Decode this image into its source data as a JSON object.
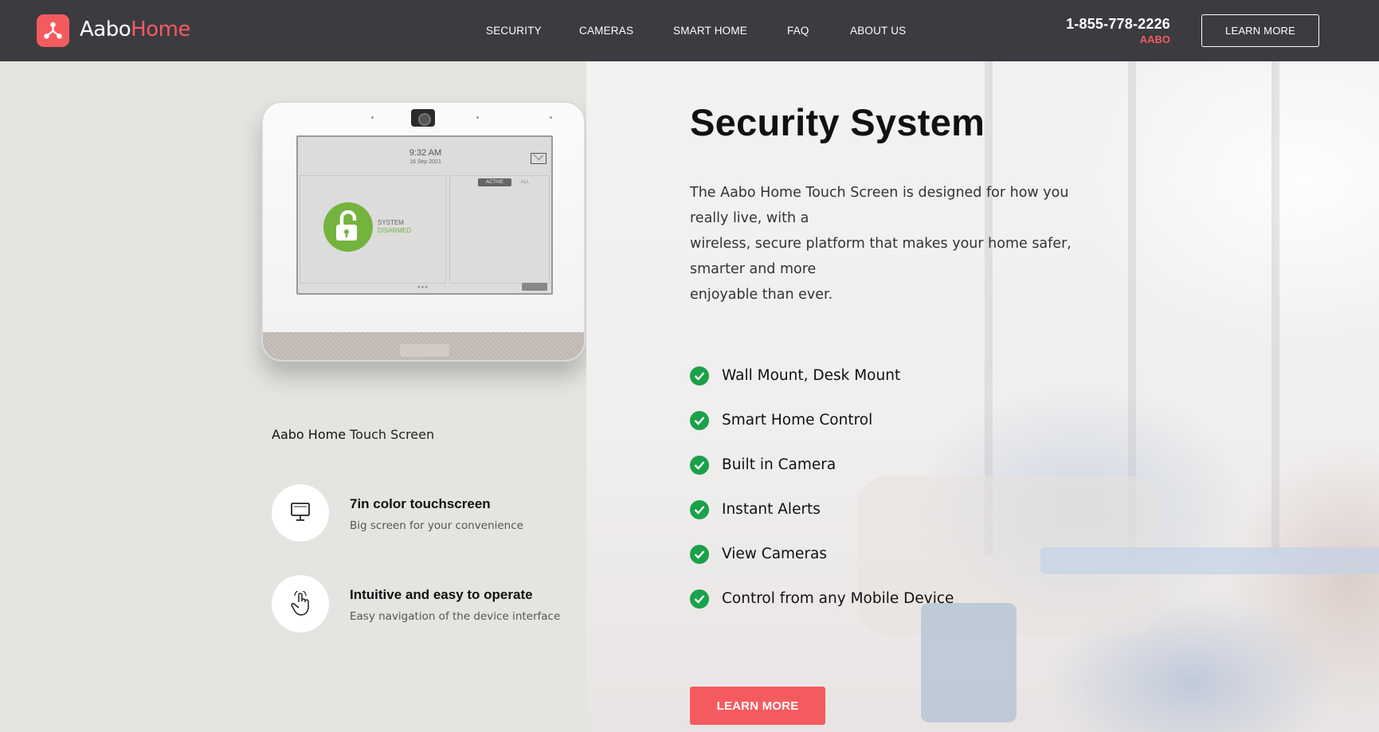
{
  "brand": {
    "name_part1": "Aabo",
    "name_part2": "Home",
    "accent_color": "#f45b5f",
    "logo_icon": "network-nodes-icon"
  },
  "nav": {
    "items": [
      {
        "label": "SECURITY"
      },
      {
        "label": "CAMERAS"
      },
      {
        "label": "SMART HOME"
      },
      {
        "label": "FAQ"
      },
      {
        "label": "ABOUT US"
      }
    ]
  },
  "header": {
    "phone": "1-855-778-2226",
    "phone_sub": "AABO",
    "cta_label": "LEARN MORE"
  },
  "device": {
    "screen_time": "9:32 AM",
    "screen_date": "16 Sep 2021",
    "tab_active": "ACTIVE",
    "tab_all": "ALL",
    "status_line1": "SYSTEM",
    "status_line2": "DISARMED",
    "status_color": "#74b33d"
  },
  "product": {
    "title_strong": "Aabo Home",
    "title_rest": " Touch Screen",
    "features": [
      {
        "icon": "monitor-icon",
        "title": "7in color touchscreen",
        "desc": "Big screen for your convenience"
      },
      {
        "icon": "touch-hand-icon",
        "title": "Intuitive and easy to operate",
        "desc": "Easy navigation of the device interface"
      }
    ]
  },
  "main": {
    "title": "Security System",
    "desc_lines": [
      "The Aabo Home Touch Screen is designed for how you really live, with a",
      "wireless, secure platform that makes your home safer, smarter and more",
      "enjoyable than ever."
    ],
    "checklist": [
      "Wall Mount, Desk Mount",
      "Smart Home Control",
      "Built in Camera",
      "Instant Alerts",
      "View Cameras",
      "Control from any Mobile Device"
    ],
    "check_color": "#1aa14a",
    "cta_label": "LEARN MORE"
  }
}
